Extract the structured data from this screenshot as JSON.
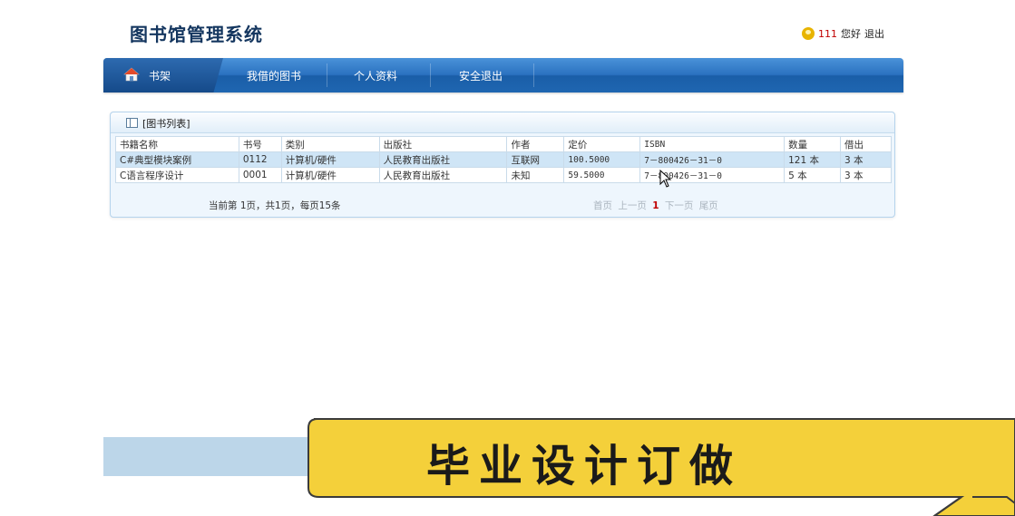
{
  "app": {
    "title": "图书馆管理系统"
  },
  "user": {
    "name": "111",
    "greeting": "您好",
    "logout": "退出"
  },
  "nav": {
    "home": "书架",
    "items": [
      "我借的图书",
      "个人资料",
      "安全退出"
    ]
  },
  "panel": {
    "title": "[图书列表]",
    "columns": [
      "书籍名称",
      "书号",
      "类别",
      "出版社",
      "作者",
      "定价",
      "ISBN",
      "数量",
      "借出"
    ],
    "rows": [
      {
        "name": "C#典型模块案例",
        "number": "0112",
        "category": "计算机/硬件",
        "publisher": "人民教育出版社",
        "author": "互联网",
        "price": "100.5000",
        "isbn": "7－800426－31－0",
        "quantity": "121 本",
        "lent": "3 本"
      },
      {
        "name": "C语言程序设计",
        "number": "0001",
        "category": "计算机/硬件",
        "publisher": "人民教育出版社",
        "author": "未知",
        "price": "59.5000",
        "isbn": "7－800426－31－0",
        "quantity": "5 本",
        "lent": "3 本"
      }
    ],
    "page_info": "当前第 1页，共1页，每页15条",
    "pager": {
      "first": "首页",
      "prev": "上一页",
      "current": "1",
      "next": "下一页",
      "last": "尾页"
    }
  },
  "promo": {
    "text": "毕业设计订做"
  },
  "colors": {
    "nav": "#2b72c0",
    "accent_red": "#c00000",
    "row_highlight": "#cfe5f6",
    "promo_yellow": "#f6d23c"
  }
}
